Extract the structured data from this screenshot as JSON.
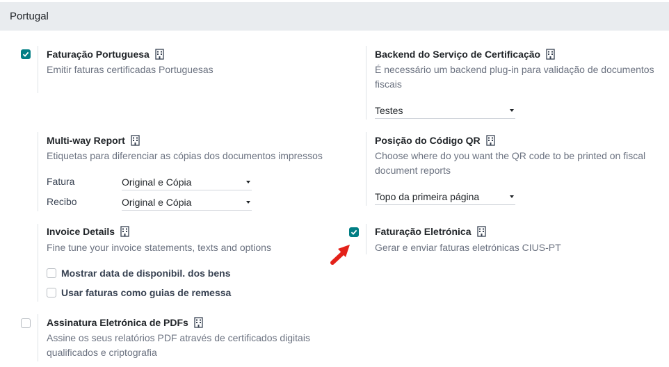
{
  "section": {
    "title": "Portugal"
  },
  "settings": {
    "faturacao_portuguesa": {
      "title": "Faturação Portuguesa",
      "desc": "Emitir faturas certificadas Portuguesas",
      "checked": true
    },
    "backend": {
      "title": "Backend do Serviço de Certificação",
      "desc_line1": "É necessário um backend plug-in para validação de documentos",
      "desc_line2": "fiscais",
      "value": "Testes"
    },
    "multiway": {
      "title": "Multi-way Report",
      "desc": "Etiquetas para diferenciar as cópias dos documentos impressos",
      "rows": [
        {
          "label": "Fatura",
          "value": "Original e Cópia"
        },
        {
          "label": "Recibo",
          "value": "Original e Cópia"
        }
      ]
    },
    "qr": {
      "title": "Posição do Código QR",
      "desc_line1": "Choose where do you want the QR code to be printed on fiscal",
      "desc_line2": "document reports",
      "value": "Topo da primeira página"
    },
    "invoice_details": {
      "title": "Invoice Details",
      "desc": "Fine tune your invoice statements, texts and options",
      "options": [
        {
          "label": "Mostrar data de disponibil. dos bens",
          "checked": false
        },
        {
          "label": "Usar faturas como guias de remessa",
          "checked": false
        }
      ]
    },
    "faturacao_eletronica": {
      "title": "Faturação Eletrónica",
      "desc": "Gerar e enviar faturas eletrónicas CIUS-PT",
      "checked": true
    },
    "assinatura": {
      "title": "Assinatura Eletrónica de PDFs",
      "desc_line1": "Assine os seus relatórios PDF através de certificados digitais",
      "desc_line2": "qualificados e criptografia",
      "checked": false
    }
  },
  "colors": {
    "accent": "#017e84",
    "header_bg": "#e9ecef",
    "annotation_arrow": "#e32119"
  },
  "icons": {
    "company": "building-icon",
    "check": "check-icon",
    "caret": "caret-down-icon",
    "annotation": "red-arrow-icon"
  }
}
